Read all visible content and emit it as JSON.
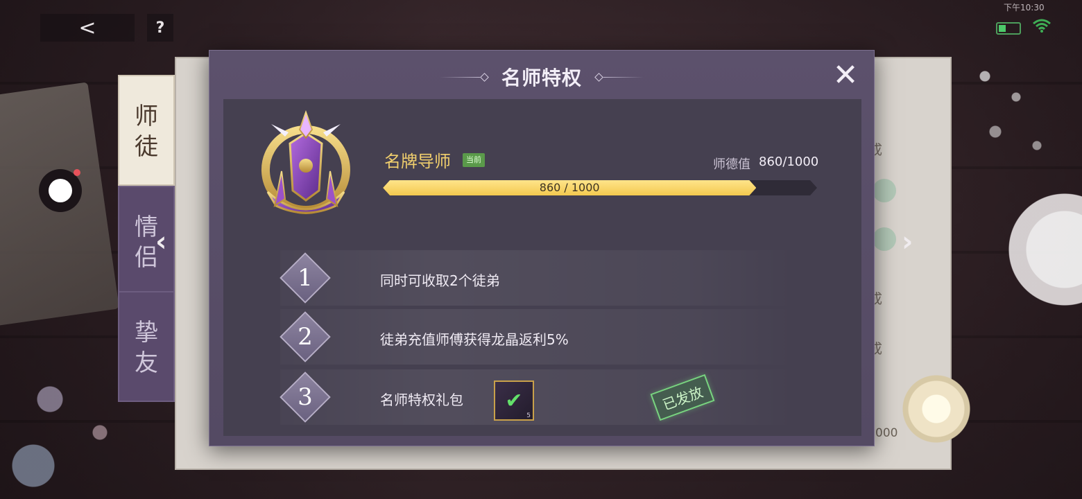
{
  "status_bar": {
    "time": "下午10:30",
    "battery_icon": "battery-icon",
    "wifi_icon": "wifi-icon"
  },
  "top_bar": {
    "back_icon": "chevron-left-icon",
    "back_glyph": "<",
    "help_label": "?"
  },
  "left_tabs": [
    {
      "label_line1": "师",
      "label_line2": "徒",
      "active": true
    },
    {
      "label_line1": "情",
      "label_line2": "侣",
      "active": false
    },
    {
      "label_line1": "挚",
      "label_line2": "友",
      "active": false
    }
  ],
  "nav_arrows": {
    "left": "‹",
    "right": "›"
  },
  "background_list": {
    "items": [
      "成",
      "成",
      "成"
    ],
    "amount": "000"
  },
  "modal": {
    "title": "名师特权",
    "close_glyph": "✕",
    "rank": {
      "name": "名牌导师",
      "current_badge": "当前",
      "virtue_label": "师德值",
      "virtue_value": "860/1000",
      "progress_text": "860 / 1000",
      "progress_current": 860,
      "progress_max": 1000
    },
    "privileges": [
      {
        "number": "1",
        "text": "同时可收取2个徒弟"
      },
      {
        "number": "2",
        "text": "徒弟充值师傅获得龙晶返利5%"
      },
      {
        "number": "3",
        "text": "名师特权礼包",
        "gift_count": "5",
        "stamp": "已发放"
      }
    ]
  },
  "colors": {
    "accent_gold": "#f1cf6d",
    "progress_fill": "#f3c94f",
    "modal_bg": "#5c516c",
    "panel_bg": "#454050",
    "stamp_green": "#79d480"
  }
}
